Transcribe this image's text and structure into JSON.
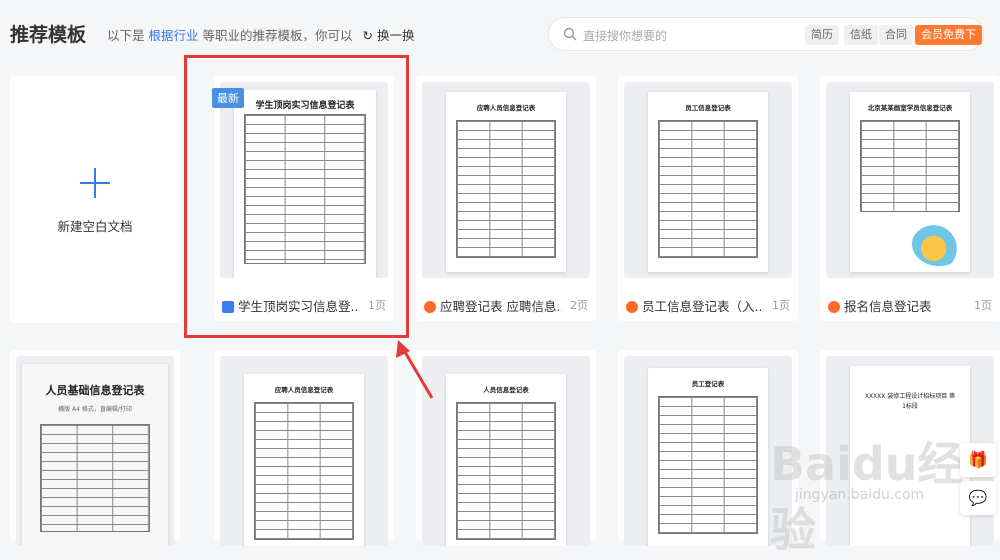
{
  "header": {
    "title": "推荐模板",
    "subtitle_prefix": "以下是",
    "subtitle_link": "根据行业",
    "subtitle_suffix": "等职业的推荐模板，你可以",
    "swap_label": "换一换",
    "search_placeholder": "直接搜你想要的",
    "chips": [
      "简历",
      "信纸",
      "合同",
      "会员免费下"
    ]
  },
  "new_doc": {
    "label": "新建空白文档"
  },
  "badge_new": "最新",
  "cards_row1": [
    {
      "name": "学生顶岗实习信息登...",
      "pages": "1页",
      "thumb_title": "学生顶岗实习信息登记表",
      "icon": "document-icon"
    },
    {
      "name": "应聘登记表 应聘信息...",
      "pages": "2页",
      "thumb_title": "应聘人员信息登记表",
      "icon": "docer-icon"
    },
    {
      "name": "员工信息登记表（入...",
      "pages": "1页",
      "thumb_title": "员工信息登记表",
      "icon": "docer-icon"
    },
    {
      "name": "报名信息登记表",
      "pages": "1页",
      "thumb_title": "北京某某画室学员信息登记表",
      "icon": "docer-icon"
    }
  ],
  "cards_row2": [
    {
      "thumb_title": "人员基础信息登记表",
      "thumb_sub": "横版 A4 格式，直编辑/打印"
    },
    {
      "thumb_title": "应聘人员信息登记表"
    },
    {
      "thumb_title": "人员信息登记表"
    },
    {
      "thumb_title": "员工登记表"
    },
    {
      "thumb_title": "XXXXX 装修工程设计招标项目 第1标段"
    }
  ],
  "watermark": {
    "text": "Baidu经验",
    "sub": "jingyan.baidu.com"
  },
  "side_buttons": {
    "gift": "gift-icon",
    "chat": "chat-icon"
  }
}
